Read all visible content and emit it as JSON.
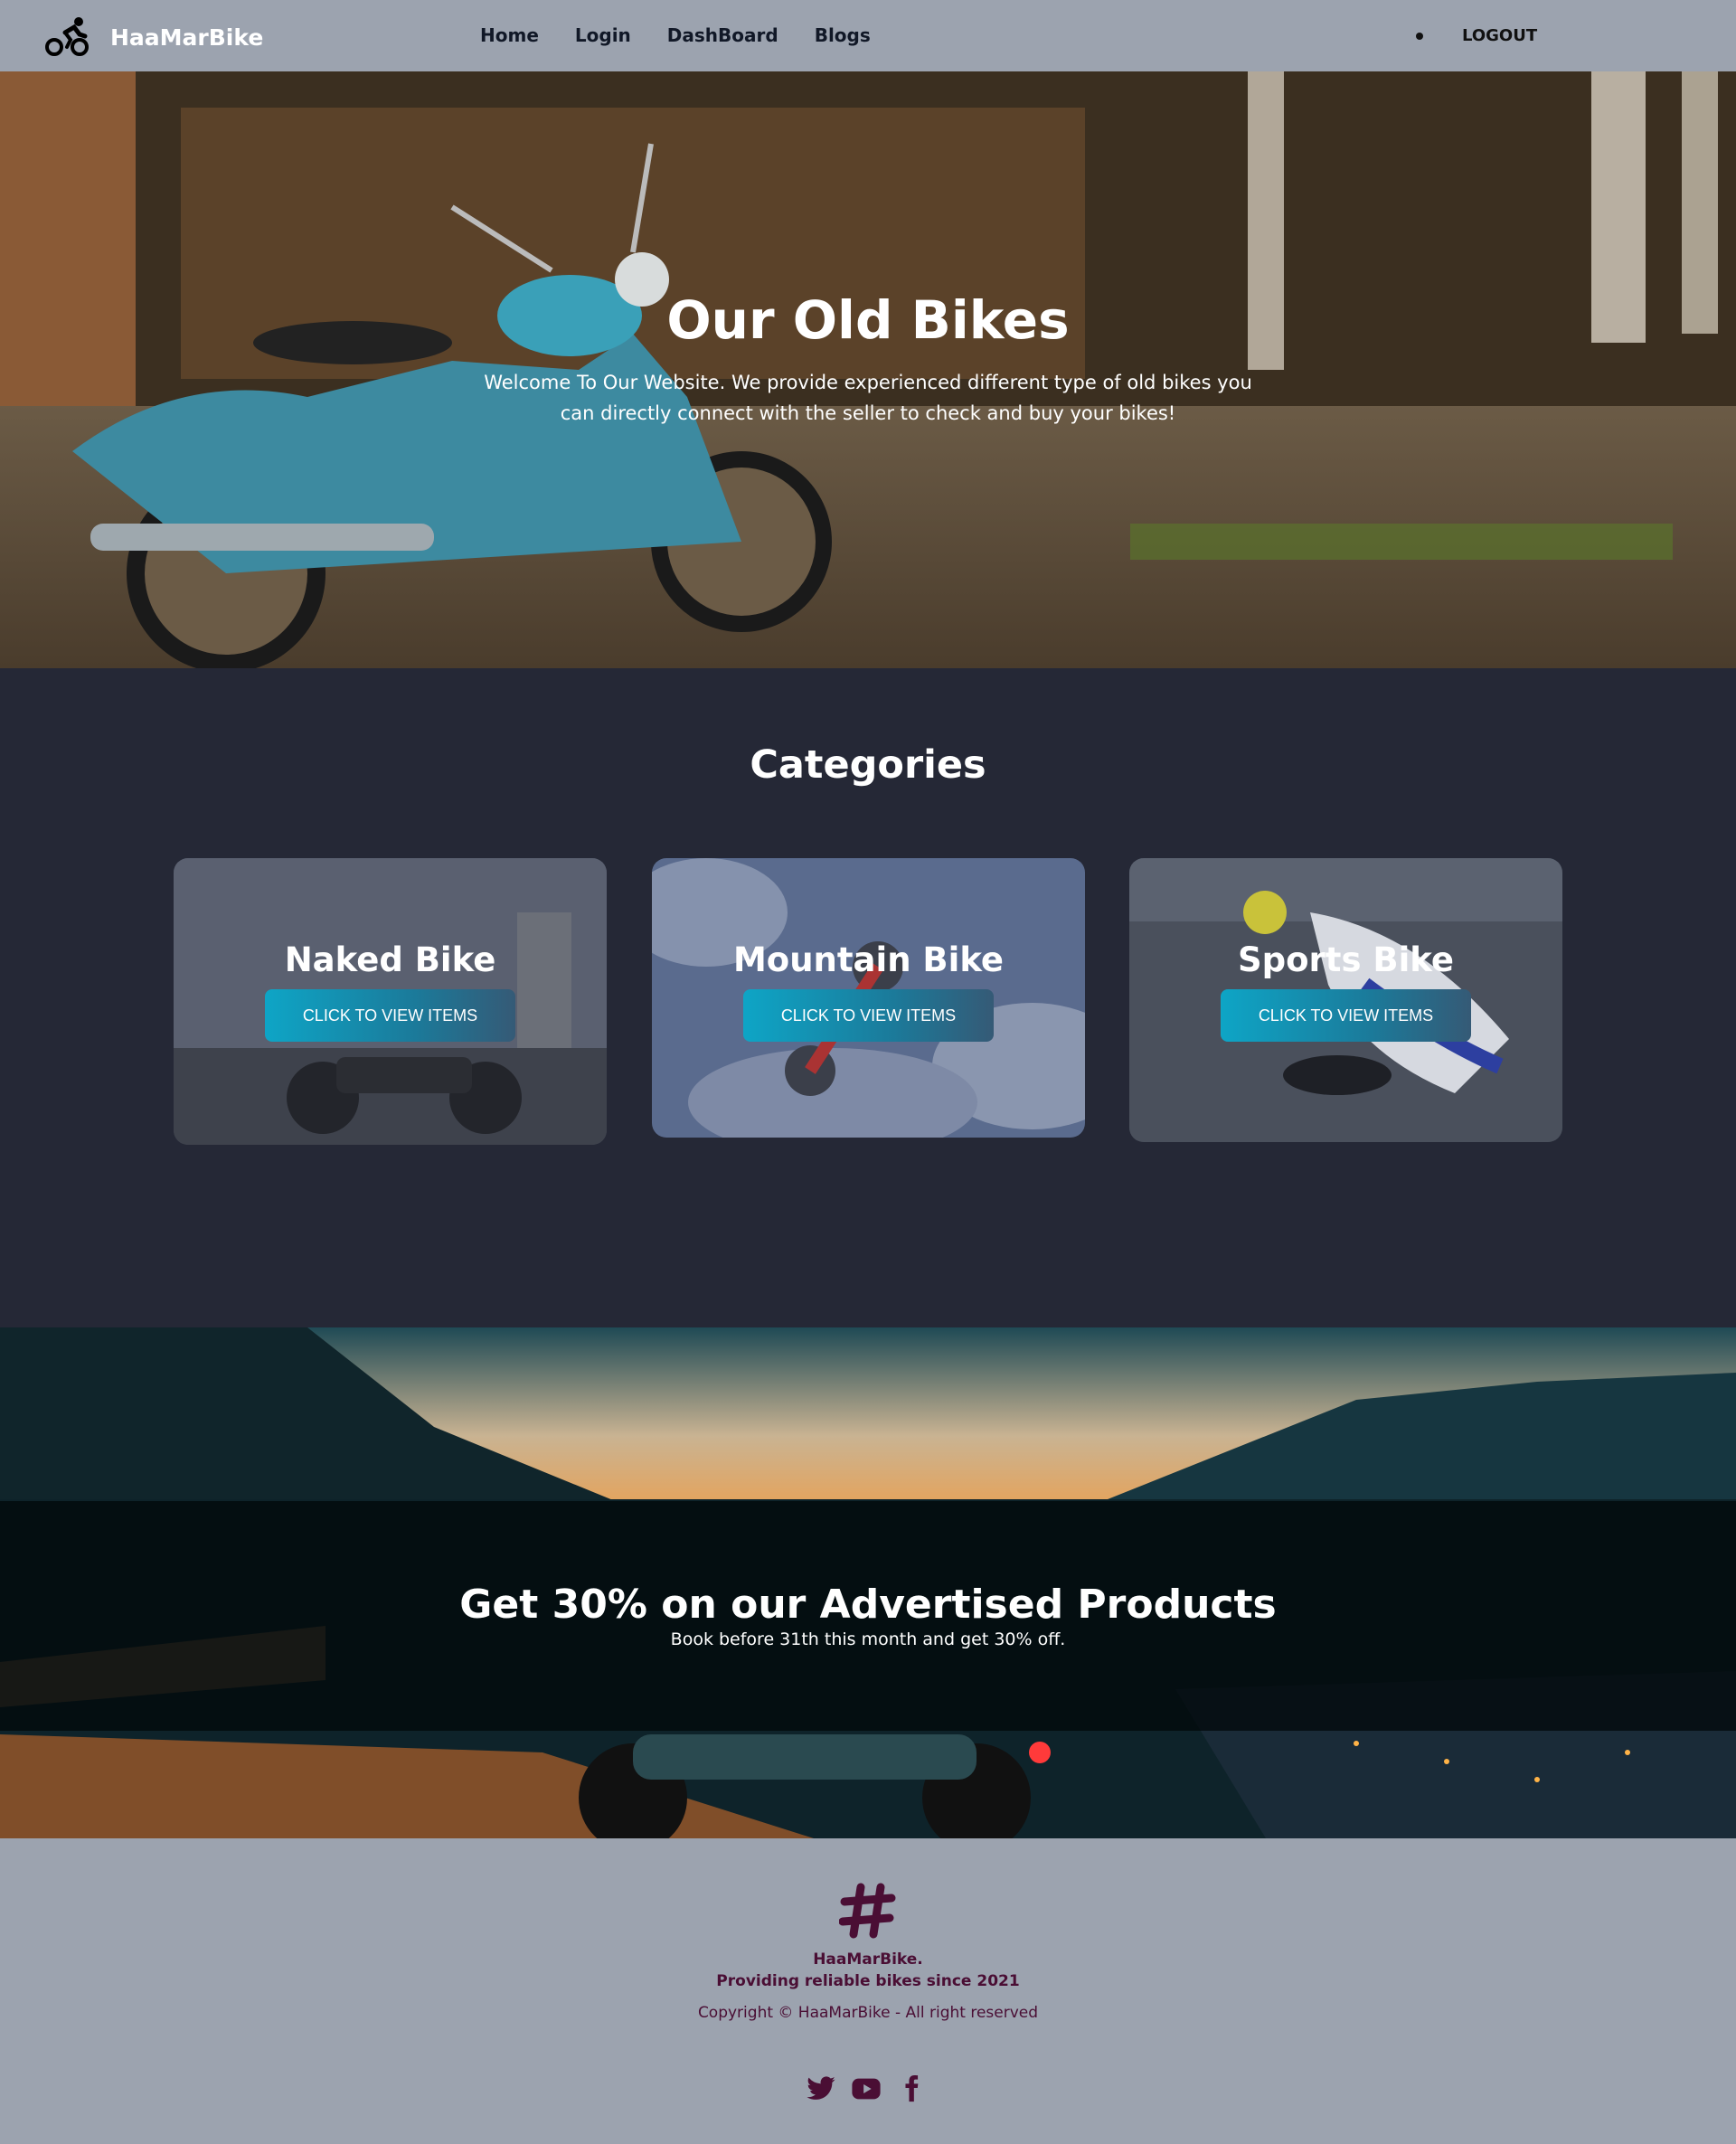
{
  "brand": {
    "name": "HaaMarBike",
    "icon": "cyclist-icon"
  },
  "nav": {
    "links": [
      {
        "label": "Home"
      },
      {
        "label": "Login"
      },
      {
        "label": "DashBoard"
      },
      {
        "label": "Blogs"
      }
    ],
    "logout_label": "LOGOUT"
  },
  "hero": {
    "title": "Our Old Bikes",
    "text": "Welcome To Our Website. We provide experienced different type of old bikes you can directly connect with the seller to check and buy your bikes!"
  },
  "categories": {
    "heading": "Categories",
    "cards": [
      {
        "title": "Naked Bike",
        "button": "CLICK TO VIEW ITEMS"
      },
      {
        "title": "Mountain Bike",
        "button": "CLICK TO VIEW ITEMS"
      },
      {
        "title": "Sports Bike",
        "button": "CLICK TO VIEW ITEMS"
      }
    ]
  },
  "promo": {
    "title": "Get 30% on our Advertised Products",
    "subtitle": "Book before 31th this month and get 30% off."
  },
  "footer": {
    "logo_icon": "hashtag-icon",
    "name": "HaaMarBike.",
    "tagline": "Providing reliable bikes since 2021",
    "copyright": "Copyright © HaaMarBike - All right reserved",
    "socials": [
      "twitter-icon",
      "youtube-icon",
      "facebook-icon"
    ]
  },
  "colors": {
    "navbar": "#9ca3af",
    "section_bg": "#252836",
    "footer_text": "#4a0e34",
    "button_accent": "#0ea5c6"
  }
}
